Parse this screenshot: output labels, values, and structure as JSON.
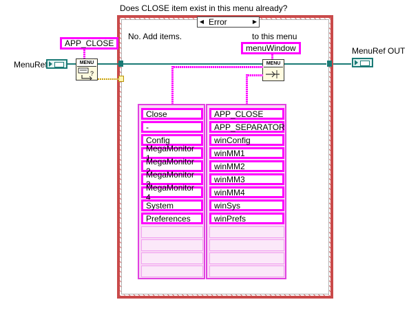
{
  "title": "Does CLOSE item exist in this menu already?",
  "case_selector": {
    "value": "Error",
    "left_arrow": "◀",
    "right_arrow": "▶"
  },
  "comments": {
    "no_add": "No.  Add items.",
    "to_menu": "to this menu"
  },
  "constants": {
    "app_close": "APP_CLOSE",
    "menu_window": "menuWindow"
  },
  "terminals": {
    "input_label": "MenuRef",
    "output_label": "MenuRef OUT"
  },
  "subvis": {
    "find_item": "MENU",
    "insert_items": "MENU"
  },
  "item_names": [
    "Close",
    "-",
    "Config",
    "MegaMonitor 1",
    "MegaMonitor 2",
    "MegaMonitor 3",
    "MegaMonitor 4",
    "System",
    "Preferences"
  ],
  "item_tags": [
    "APP_CLOSE",
    "APP_SEPARATOR",
    "winConfig",
    "winMM1",
    "winMM2",
    "winMM3",
    "winMM4",
    "winSys",
    "winPrefs"
  ],
  "colors": {
    "ref_wire": "#1a7a75",
    "string_wire": "#ff00ff",
    "case_border": "#c94a4a"
  }
}
